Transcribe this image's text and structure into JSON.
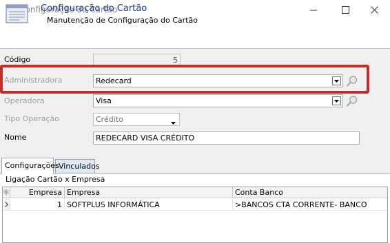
{
  "window": {
    "title": "Configuração do Cartão"
  },
  "header": {
    "title": "Configuração do Cartão",
    "subtitle": "Manutenção de Configuração do Cartão"
  },
  "form": {
    "codigo": {
      "label": "Código",
      "value": "5"
    },
    "administradora": {
      "label": "Administradora",
      "value": "Redecard"
    },
    "operadora": {
      "label": "Operadora",
      "value": "Visa"
    },
    "tipo_operacao": {
      "label": "Tipo Operação",
      "value": "Crédito"
    },
    "nome": {
      "label": "Nome",
      "value": "REDECARD VISA CRÉDITO"
    }
  },
  "tabs": [
    {
      "label": "Configurações",
      "active": true
    },
    {
      "label": "Vinculados",
      "active": false
    }
  ],
  "group": {
    "label": "Ligação Cartão x Empresa"
  },
  "grid": {
    "columns": [
      "Empresa",
      "Empresa",
      "Conta Banco"
    ],
    "rows": [
      {
        "empresa_id": "1",
        "empresa": "SOFTPLUS INFORMÁTICA",
        "conta_banco": ">BANCOS CTA CORRENTE- BANCO"
      }
    ]
  },
  "colors": {
    "header_title": "#1a3a8a",
    "highlight": "#c0302b",
    "form_bg": "#f0f0f0"
  }
}
